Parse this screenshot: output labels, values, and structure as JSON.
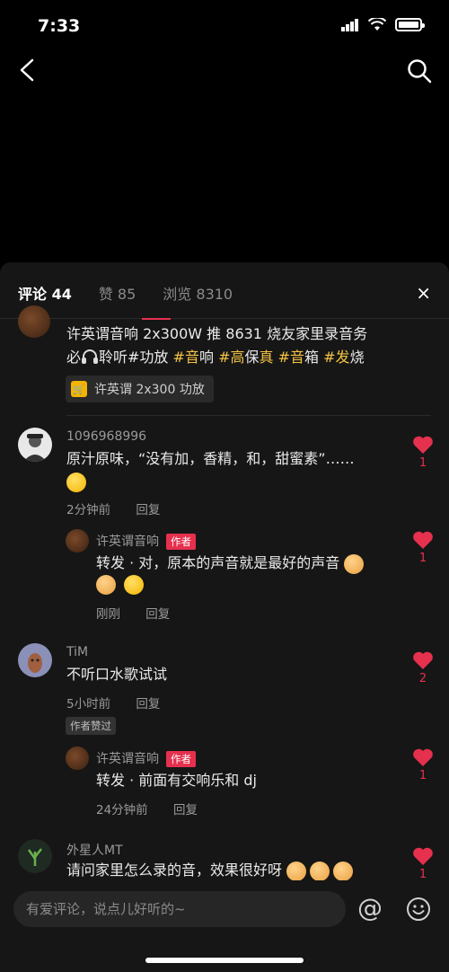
{
  "status_bar": {
    "time": "7:33"
  },
  "tabs": [
    {
      "label": "评论 44",
      "active": true
    },
    {
      "label": "赞 85",
      "active": false
    },
    {
      "label": "浏览 8310",
      "active": false
    }
  ],
  "close_label": "×",
  "post": {
    "line1": "许英谓音响 2x300W 推 8631 烧友家里录音务",
    "line2_prefix": "必",
    "line2_rest": "聆听#功放",
    "hashtags": [
      "#音",
      "响",
      "#高",
      "保",
      "真",
      "#音",
      "箱",
      "#发",
      "烧"
    ],
    "product_link": "许英谓 2x300 功放"
  },
  "comments": [
    {
      "user": "1096968996",
      "text": "原汁原味，“没有加，香精，和，甜蜜素”……",
      "time": "2分钟前",
      "reply": "回复",
      "likes": "1",
      "reply_item": {
        "user": "许英谓音响",
        "author_tag": "作者",
        "text": "转发 · 对，原本的声音就是最好的声音",
        "time": "刚刚",
        "reply": "回复",
        "likes": "1"
      }
    },
    {
      "user": "TiM",
      "text": "不听口水歌试试",
      "time": "5小时前",
      "reply": "回复",
      "badge": "作者赞过",
      "likes": "2",
      "reply_item": {
        "user": "许英谓音响",
        "author_tag": "作者",
        "text": "转发 · 前面有交响乐和 dj",
        "time": "24分钟前",
        "reply": "回复",
        "likes": "1"
      }
    },
    {
      "user": "外星人MT",
      "text": "请问家里怎么录的音，效果很好呀",
      "likes": "1"
    }
  ],
  "input": {
    "placeholder": "有爱评论，说点儿好听的~"
  },
  "colors": {
    "accent": "#e5304e",
    "hashtag": "#f4c343",
    "sheet": "#161616"
  }
}
